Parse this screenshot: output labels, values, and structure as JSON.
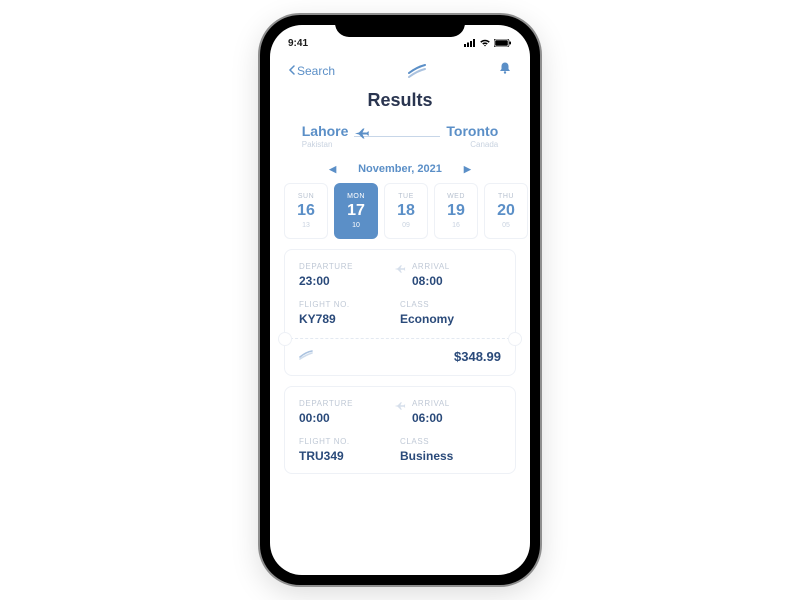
{
  "status": {
    "time": "9:41"
  },
  "nav": {
    "back_label": "Search"
  },
  "title": "Results",
  "route": {
    "origin_city": "Lahore",
    "origin_country": "Pakistan",
    "dest_city": "Toronto",
    "dest_country": "Canada"
  },
  "month": {
    "label": "November, 2021"
  },
  "days": [
    {
      "dow": "SUN",
      "num": "16",
      "sub": "13",
      "selected": false
    },
    {
      "dow": "MON",
      "num": "17",
      "sub": "10",
      "selected": true
    },
    {
      "dow": "TUE",
      "num": "18",
      "sub": "09",
      "selected": false
    },
    {
      "dow": "WED",
      "num": "19",
      "sub": "16",
      "selected": false
    },
    {
      "dow": "THU",
      "num": "20",
      "sub": "05",
      "selected": false
    }
  ],
  "flights": [
    {
      "labels": {
        "departure": "DEPARTURE",
        "arrival": "ARRIVAL",
        "flight_no": "FLIGHT NO.",
        "class": "CLASS"
      },
      "departure": "23:00",
      "arrival": "08:00",
      "flight_no": "KY789",
      "class": "Economy",
      "price": "$348.99"
    },
    {
      "labels": {
        "departure": "DEPARTURE",
        "arrival": "ARRIVAL",
        "flight_no": "FLIGHT NO.",
        "class": "CLASS"
      },
      "departure": "00:00",
      "arrival": "06:00",
      "flight_no": "TRU349",
      "class": "Business",
      "price": ""
    }
  ]
}
